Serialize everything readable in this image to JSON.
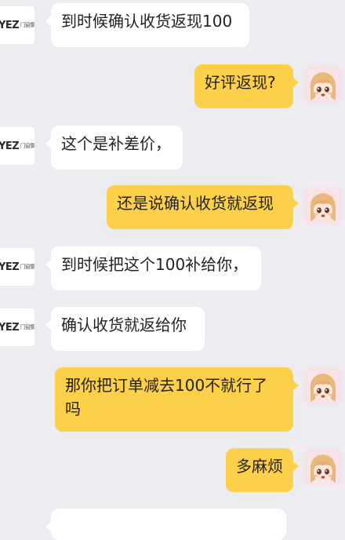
{
  "chat": {
    "seller_avatar_logo": "YEZ",
    "seller_avatar_sub": "门窗集成",
    "buyer_avatar_icon": "anime-girl-avatar-icon",
    "colors": {
      "background": "#ececf1",
      "incoming_bubble": "#ffffff",
      "outgoing_bubble": "#fdd049"
    },
    "messages": [
      {
        "side": "left",
        "text": "到时候确认收货返现100"
      },
      {
        "side": "right",
        "text": "好评返现?"
      },
      {
        "side": "left",
        "text": "这个是补差价，"
      },
      {
        "side": "right",
        "text": "还是说确认收货就返现"
      },
      {
        "side": "left",
        "text": "到时候把这个100补给你，"
      },
      {
        "side": "left",
        "text": "确认收货就返给你"
      },
      {
        "side": "right",
        "text": "那你把订单减去100不就行了\n吗"
      },
      {
        "side": "right",
        "text": "多麻烦"
      }
    ]
  }
}
